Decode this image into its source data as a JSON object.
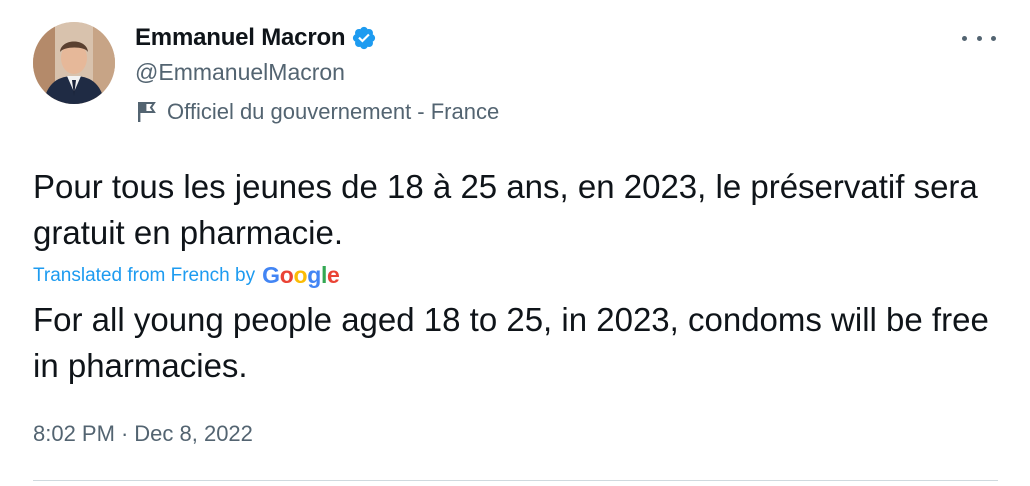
{
  "author": {
    "display_name": "Emmanuel Macron",
    "handle": "@EmmanuelMacron",
    "verified": true,
    "label": "Officiel du gouvernement - France"
  },
  "tweet": {
    "text": "Pour tous les jeunes de 18 à 25 ans, en 2023, le préservatif sera gratuit en pharmacie.",
    "translated_label": "Translated from French by",
    "translator_brand": [
      "G",
      "o",
      "o",
      "g",
      "l",
      "e"
    ],
    "translation": "For all young people aged 18 to 25, in 2023, condoms will be free in pharmacies.",
    "time": "8:02 PM",
    "separator": "·",
    "date": "Dec 8, 2022"
  },
  "icons": {
    "verified": "verified-badge-icon",
    "flag": "flag-icon",
    "more": "more-icon"
  },
  "colors": {
    "accent": "#1d9bf0",
    "text_primary": "#0f1419",
    "text_secondary": "#536471",
    "divider": "#cfd9de"
  }
}
